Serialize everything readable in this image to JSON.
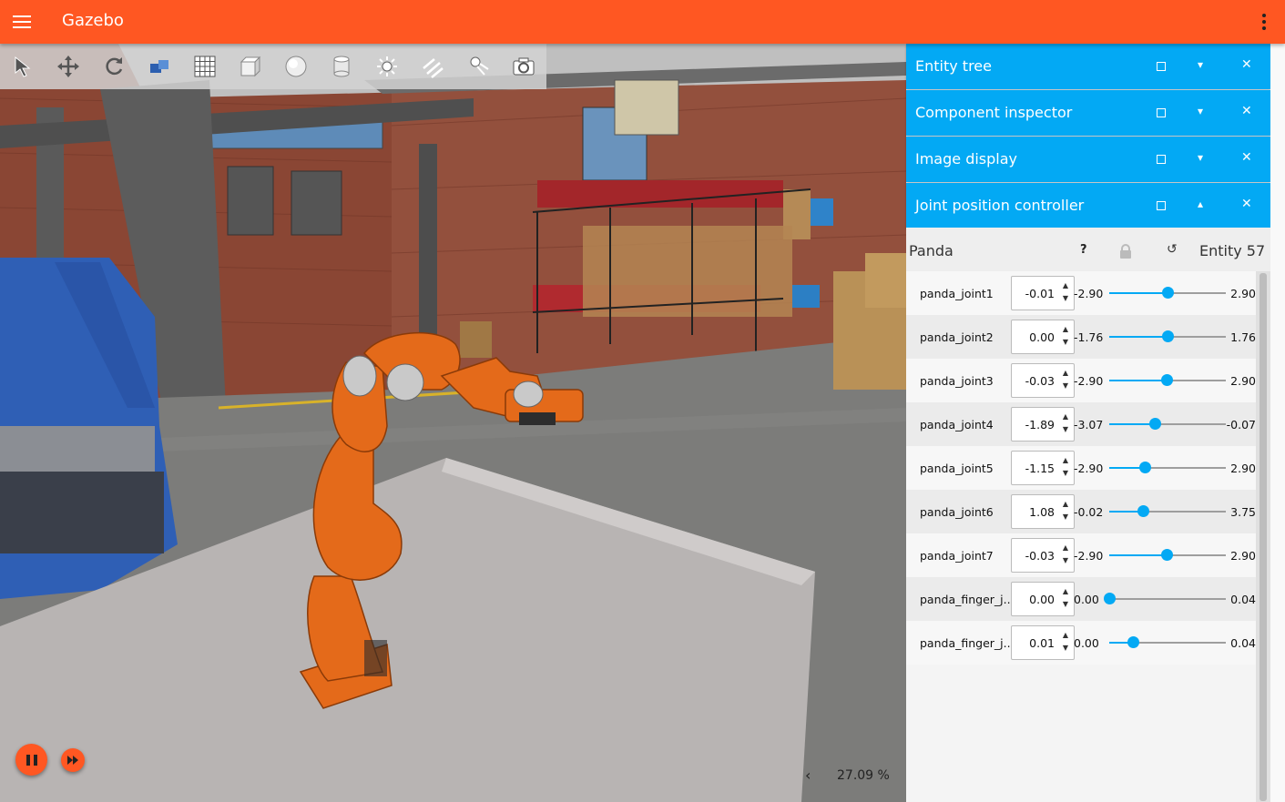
{
  "header": {
    "title": "Gazebo",
    "menu_icon": "hamburger-icon",
    "more_icon": "more-vert-icon",
    "color": "#ff5722"
  },
  "toolbar": {
    "tools": [
      {
        "name": "select-tool",
        "icon": "arrow-cursor-icon"
      },
      {
        "name": "translate-tool",
        "icon": "move-arrows-icon"
      },
      {
        "name": "rotate-tool",
        "icon": "rotate-icon"
      },
      {
        "name": "transform-snap-tool",
        "icon": "snap-icon"
      },
      {
        "name": "grid-tool",
        "icon": "grid-icon"
      },
      {
        "name": "box-tool",
        "icon": "box-icon"
      },
      {
        "name": "sphere-tool",
        "icon": "sphere-icon"
      },
      {
        "name": "cylinder-tool",
        "icon": "cylinder-icon"
      },
      {
        "name": "point-light-tool",
        "icon": "sun-icon"
      },
      {
        "name": "directional-light-tool",
        "icon": "directional-light-icon"
      },
      {
        "name": "spot-light-tool",
        "icon": "spotlight-icon"
      },
      {
        "name": "screenshot-tool",
        "icon": "camera-icon"
      }
    ]
  },
  "playback": {
    "pause_icon": "pause-icon",
    "step_icon": "fast-forward-icon",
    "rtf_chevron": "‹",
    "rtf": "27.09 %"
  },
  "panels": [
    {
      "title": "Entity tree",
      "collapse": "▾"
    },
    {
      "title": "Component inspector",
      "collapse": "▾"
    },
    {
      "title": "Image display",
      "collapse": "▾"
    },
    {
      "title": "Joint position controller",
      "collapse": "▴"
    }
  ],
  "panel_controls": {
    "close": "✕"
  },
  "joint_controller": {
    "model": "Panda",
    "help": "?",
    "reset": "↺",
    "entity": "Entity 57",
    "joints": [
      {
        "name": "panda_joint1",
        "value": "-0.01",
        "min": "-2.90",
        "max": "2.90",
        "fraction": 0.498
      },
      {
        "name": "panda_joint2",
        "value": "0.00",
        "min": "-1.76",
        "max": "1.76",
        "fraction": 0.5
      },
      {
        "name": "panda_joint3",
        "value": "-0.03",
        "min": "-2.90",
        "max": "2.90",
        "fraction": 0.495
      },
      {
        "name": "panda_joint4",
        "value": "-1.89",
        "min": "-3.07",
        "max": "-0.07",
        "fraction": 0.393
      },
      {
        "name": "panda_joint5",
        "value": "-1.15",
        "min": "-2.90",
        "max": "2.90",
        "fraction": 0.302
      },
      {
        "name": "panda_joint6",
        "value": "1.08",
        "min": "-0.02",
        "max": "3.75",
        "fraction": 0.292
      },
      {
        "name": "panda_joint7",
        "value": "-0.03",
        "min": "-2.90",
        "max": "2.90",
        "fraction": 0.495
      },
      {
        "name": "panda_finger_j...",
        "value": "0.00",
        "min": "0.00",
        "max": "0.04",
        "fraction": 0.0
      },
      {
        "name": "panda_finger_j...",
        "value": "0.01",
        "min": "0.00",
        "max": "0.04",
        "fraction": 0.2
      }
    ]
  },
  "colors": {
    "accent": "#ff5722",
    "panel_bar": "#03a9f4",
    "slider": "#03a9f4"
  }
}
